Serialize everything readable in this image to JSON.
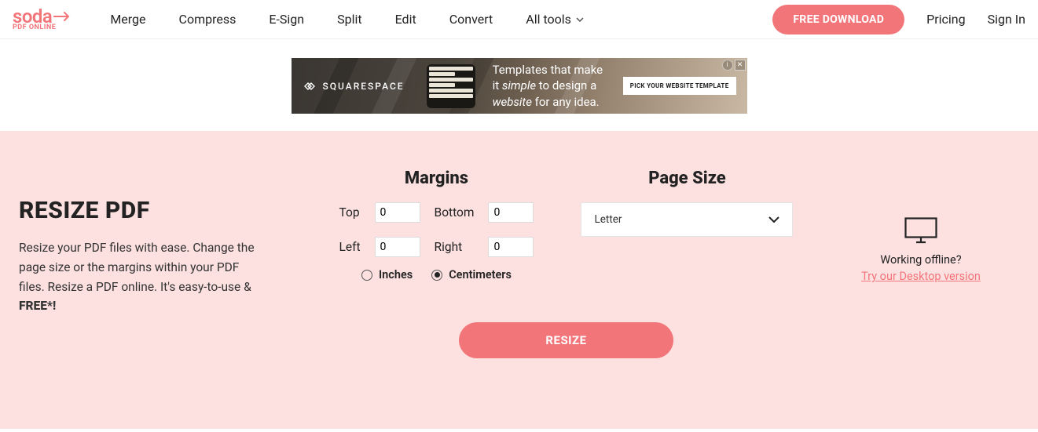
{
  "logo": {
    "main": "soda",
    "sub": "PDF ONLINE"
  },
  "nav": [
    "Merge",
    "Compress",
    "E-Sign",
    "Split",
    "Edit",
    "Convert",
    "All tools"
  ],
  "cta": "FREE DOWNLOAD",
  "rightNav": [
    "Pricing",
    "Sign In"
  ],
  "ad": {
    "brand": "SQUARESPACE",
    "line1": "Templates that make",
    "line2_a": "it ",
    "line2_b": "simple",
    "line2_c": " to design a",
    "line3_a": "website",
    "line3_b": " for any idea.",
    "button": "PICK YOUR WEBSITE TEMPLATE"
  },
  "hero": {
    "title": "RESIZE PDF",
    "desc_a": "Resize your PDF files with ease. Change the page size or the margins within your PDF files. Resize a PDF online. It's easy-to-use & ",
    "desc_b": "FREE*!"
  },
  "margins": {
    "heading": "Margins",
    "top": {
      "label": "Top",
      "value": "0"
    },
    "bottom": {
      "label": "Bottom",
      "value": "0"
    },
    "left": {
      "label": "Left",
      "value": "0"
    },
    "right": {
      "label": "Right",
      "value": "0"
    },
    "units": {
      "inches": "Inches",
      "centimeters": "Centimeters",
      "selected": "centimeters"
    }
  },
  "pageSize": {
    "heading": "Page Size",
    "selected": "Letter"
  },
  "resizeButton": "RESIZE",
  "offline": {
    "text": "Working offline?",
    "link": "Try our Desktop version"
  }
}
